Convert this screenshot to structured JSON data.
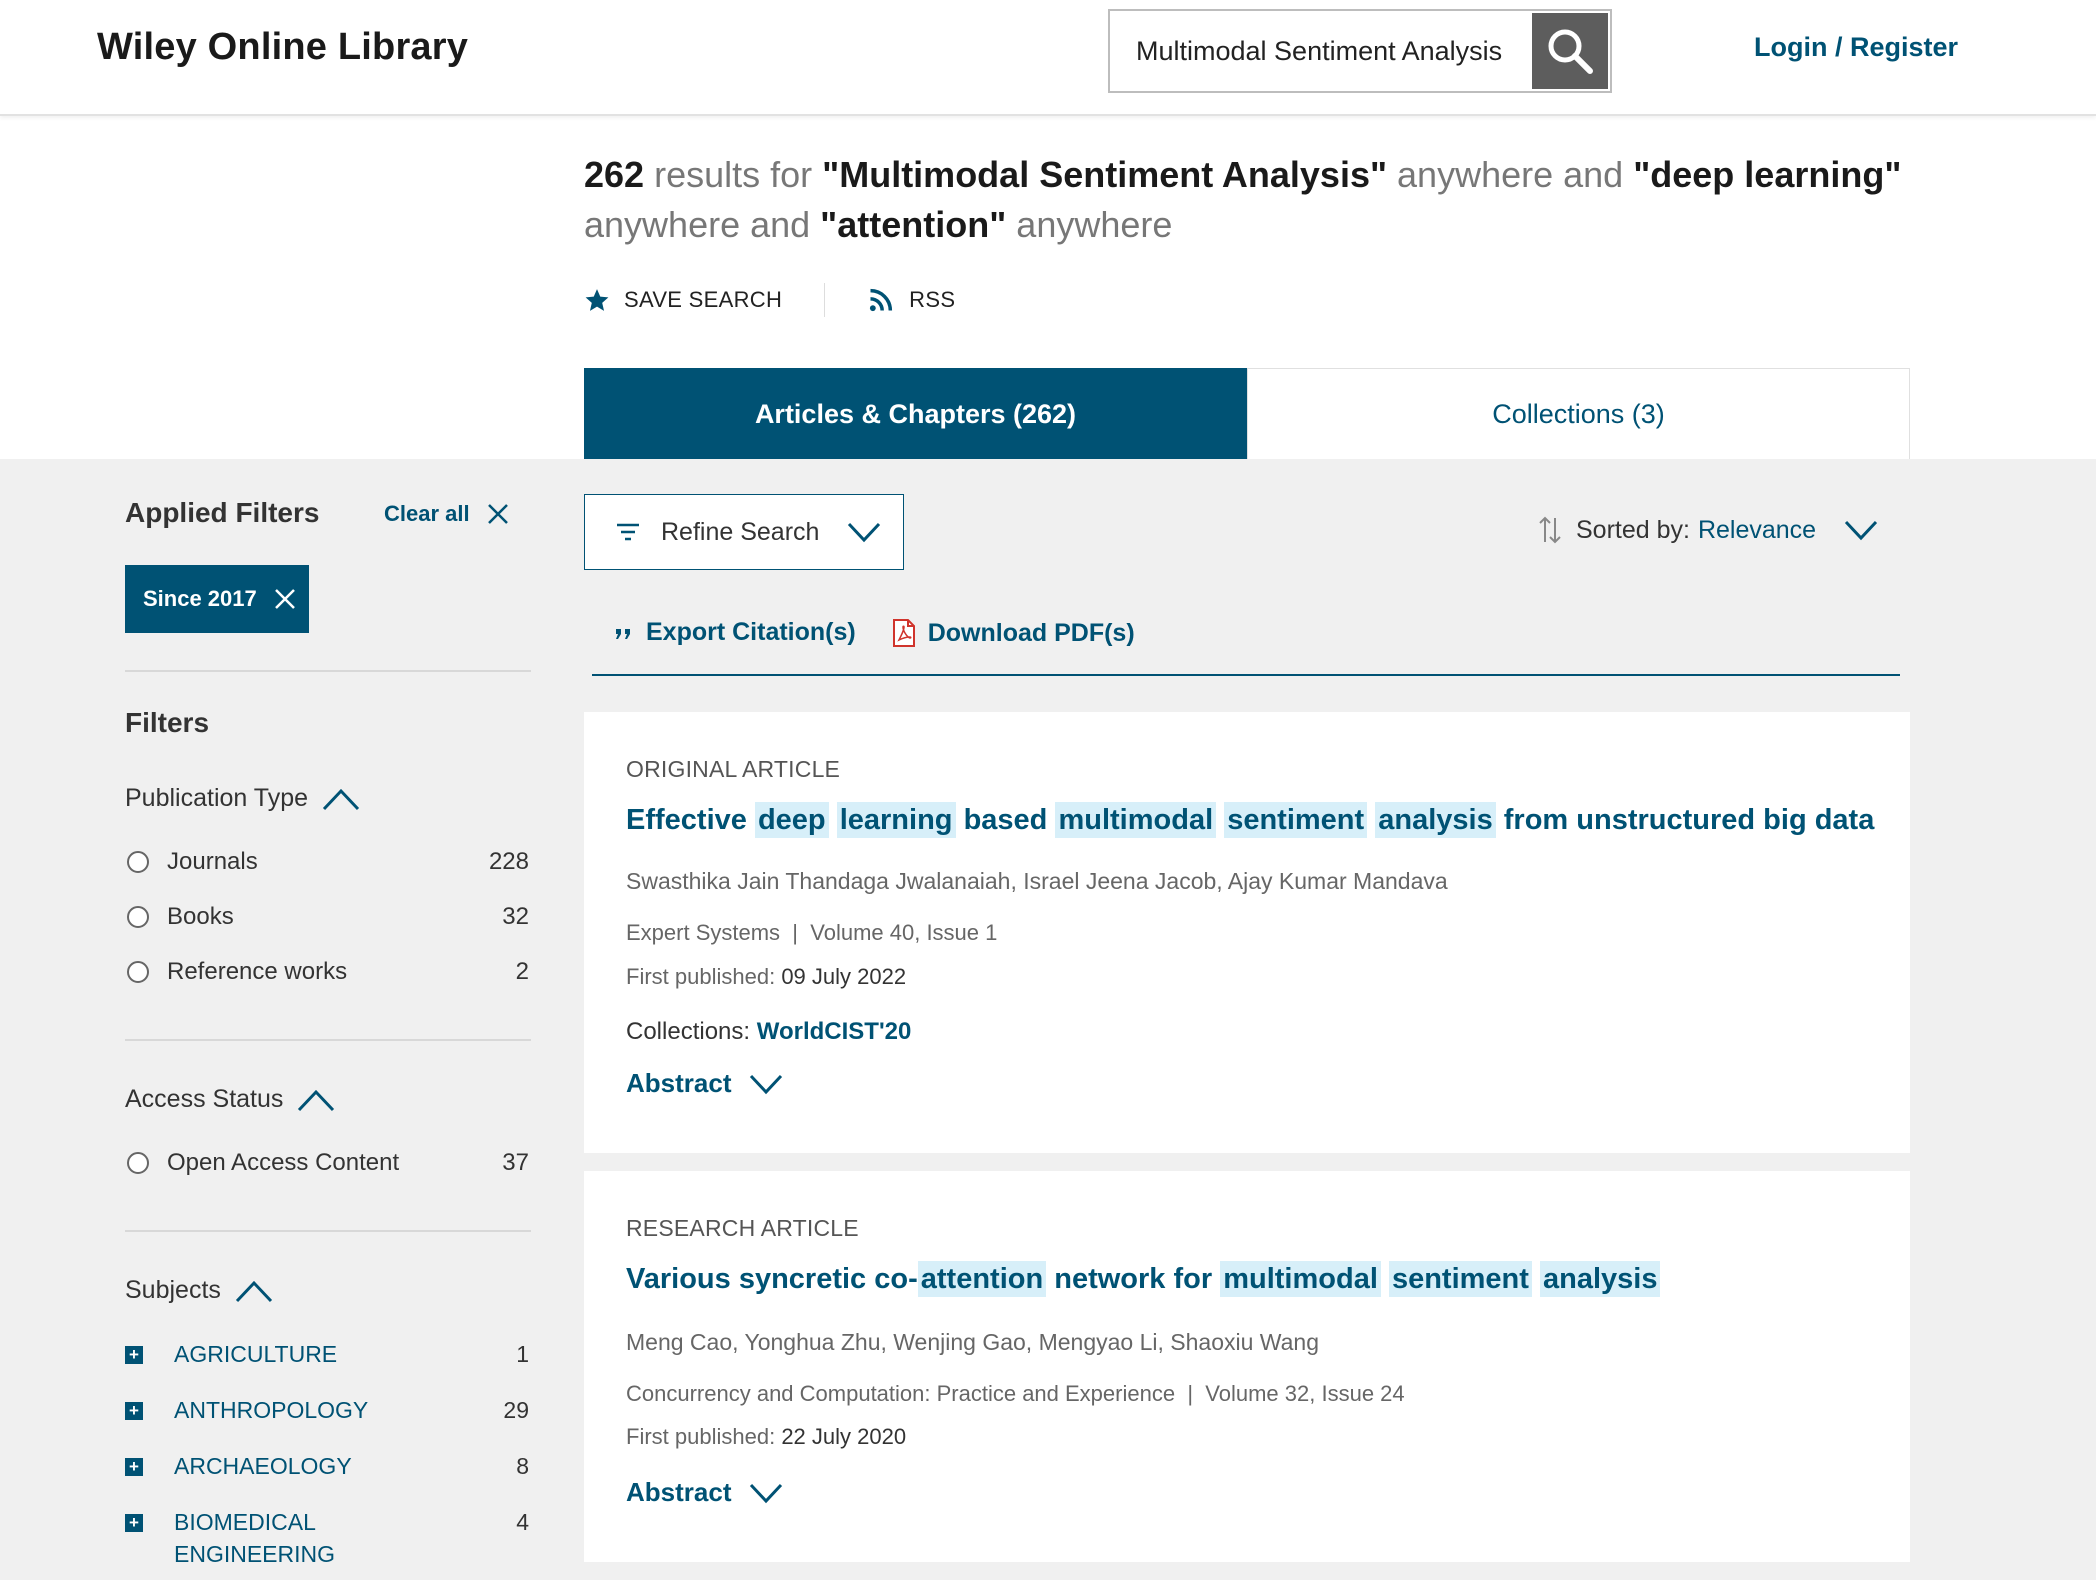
{
  "header": {
    "logo": "Wiley Online Library",
    "search_value": "Multimodal Sentiment Analysis",
    "login_label": "Login / Register"
  },
  "results": {
    "count": "262",
    "t1": " results for ",
    "term1": "\"Multimodal Sentiment Analysis\"",
    "t2": " anywhere and ",
    "term2": "\"deep learning\"",
    "t3": " anywhere and ",
    "term3": "\"attention\"",
    "t4": " anywhere"
  },
  "actions": {
    "save_search": "SAVE SEARCH",
    "rss": "RSS"
  },
  "tabs": [
    {
      "label": "Articles & Chapters (262)",
      "active": true
    },
    {
      "label": "Collections (3)",
      "active": false
    }
  ],
  "sidebar": {
    "applied_title": "Applied Filters",
    "clear_all": "Clear all",
    "chip": "Since 2017",
    "filters_title": "Filters",
    "publication_type": {
      "label": "Publication Type",
      "options": [
        {
          "label": "Journals",
          "count": "228"
        },
        {
          "label": "Books",
          "count": "32"
        },
        {
          "label": "Reference works",
          "count": "2"
        }
      ]
    },
    "access_status": {
      "label": "Access Status",
      "options": [
        {
          "label": "Open Access Content",
          "count": "37"
        }
      ]
    },
    "subjects": {
      "label": "Subjects",
      "items": [
        {
          "label": "AGRICULTURE",
          "count": "1"
        },
        {
          "label": "ANTHROPOLOGY",
          "count": "29"
        },
        {
          "label": "ARCHAEOLOGY",
          "count": "8"
        },
        {
          "label": "BIOMEDICAL ENGINEERING",
          "count": "4"
        }
      ]
    }
  },
  "toolbar": {
    "refine": "Refine Search",
    "sorted_by": "Sorted by:",
    "sort_value": "Relevance",
    "export": "Export Citation(s)",
    "download": "Download PDF(s)"
  },
  "articles": [
    {
      "type": "ORIGINAL ARTICLE",
      "title_parts": [
        {
          "t": "Effective ",
          "hl": false
        },
        {
          "t": "deep",
          "hl": true
        },
        {
          "t": " ",
          "hl": false
        },
        {
          "t": "learning",
          "hl": true
        },
        {
          "t": " based ",
          "hl": false
        },
        {
          "t": "multimodal",
          "hl": true
        },
        {
          "t": " ",
          "hl": false
        },
        {
          "t": "sentiment",
          "hl": true
        },
        {
          "t": " ",
          "hl": false
        },
        {
          "t": "analysis",
          "hl": true
        },
        {
          "t": " from unstructured big data",
          "hl": false
        }
      ],
      "authors": "Swasthika Jain Thandaga Jwalanaiah, Israel Jeena Jacob, Ajay Kumar Mandava",
      "journal": "Expert Systems",
      "volume": "Volume 40, Issue 1",
      "published_label": "First published:",
      "published_date": "09 July 2022",
      "collections_label": "Collections:",
      "collections_value": "WorldCIST'20",
      "abstract": "Abstract"
    },
    {
      "type": "RESEARCH ARTICLE",
      "title_parts": [
        {
          "t": "Various syncretic co-",
          "hl": false
        },
        {
          "t": "attention",
          "hl": true
        },
        {
          "t": " network for ",
          "hl": false
        },
        {
          "t": "multimodal",
          "hl": true
        },
        {
          "t": " ",
          "hl": false
        },
        {
          "t": "sentiment",
          "hl": true
        },
        {
          "t": " ",
          "hl": false
        },
        {
          "t": "analysis",
          "hl": true
        }
      ],
      "authors": "Meng Cao, Yonghua Zhu, Wenjing Gao, Mengyao Li, Shaoxiu Wang",
      "journal": "Concurrency and Computation: Practice and Experience",
      "volume": "Volume 32, Issue 24",
      "published_label": "First published:",
      "published_date": "22 July 2020",
      "abstract": "Abstract"
    }
  ],
  "colors": {
    "brand": "#005274",
    "highlight": "#d7eff9",
    "pdf_red": "#d0342c",
    "band_grey": "#f0f0f0"
  }
}
